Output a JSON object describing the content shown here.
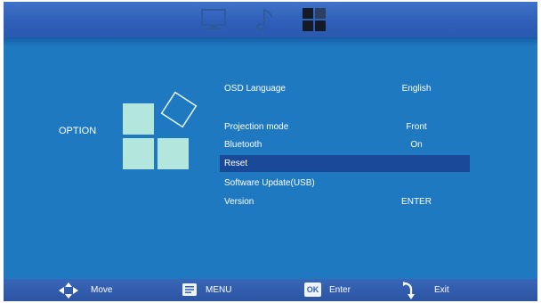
{
  "colors": {
    "background": "#1e79c0",
    "topbar": "#3464bd",
    "bottombar": "#3160b0",
    "selection": "#1a4a97",
    "tile": "#b3e6dc",
    "inactive_icon": "#2e5b9f",
    "active_icon": "#141a26"
  },
  "tabs": {
    "tv_icon": "monitor-icon",
    "music_icon": "music-note-icon",
    "option_icon": "four-squares-icon",
    "active": "option"
  },
  "section": {
    "title": "OPTION",
    "graphic_icon": "option-tiles-icon"
  },
  "menu": {
    "items": [
      {
        "label": "OSD Language",
        "value": "English"
      },
      {
        "label": "Projection mode",
        "value": "Front"
      },
      {
        "label": "Bluetooth",
        "value": "On"
      },
      {
        "label": "Reset",
        "value": "",
        "selected": true
      },
      {
        "label": "Software Update(USB)",
        "value": ""
      },
      {
        "label": "Version",
        "value": "ENTER"
      }
    ]
  },
  "hints": [
    {
      "icon": "four-way-arrows-icon",
      "label": "Move"
    },
    {
      "icon": "menu-icon",
      "label": "MENU"
    },
    {
      "icon": "ok-icon",
      "label": "Enter",
      "icon_text": "OK"
    },
    {
      "icon": "return-arrow-icon",
      "label": "Exit"
    }
  ]
}
